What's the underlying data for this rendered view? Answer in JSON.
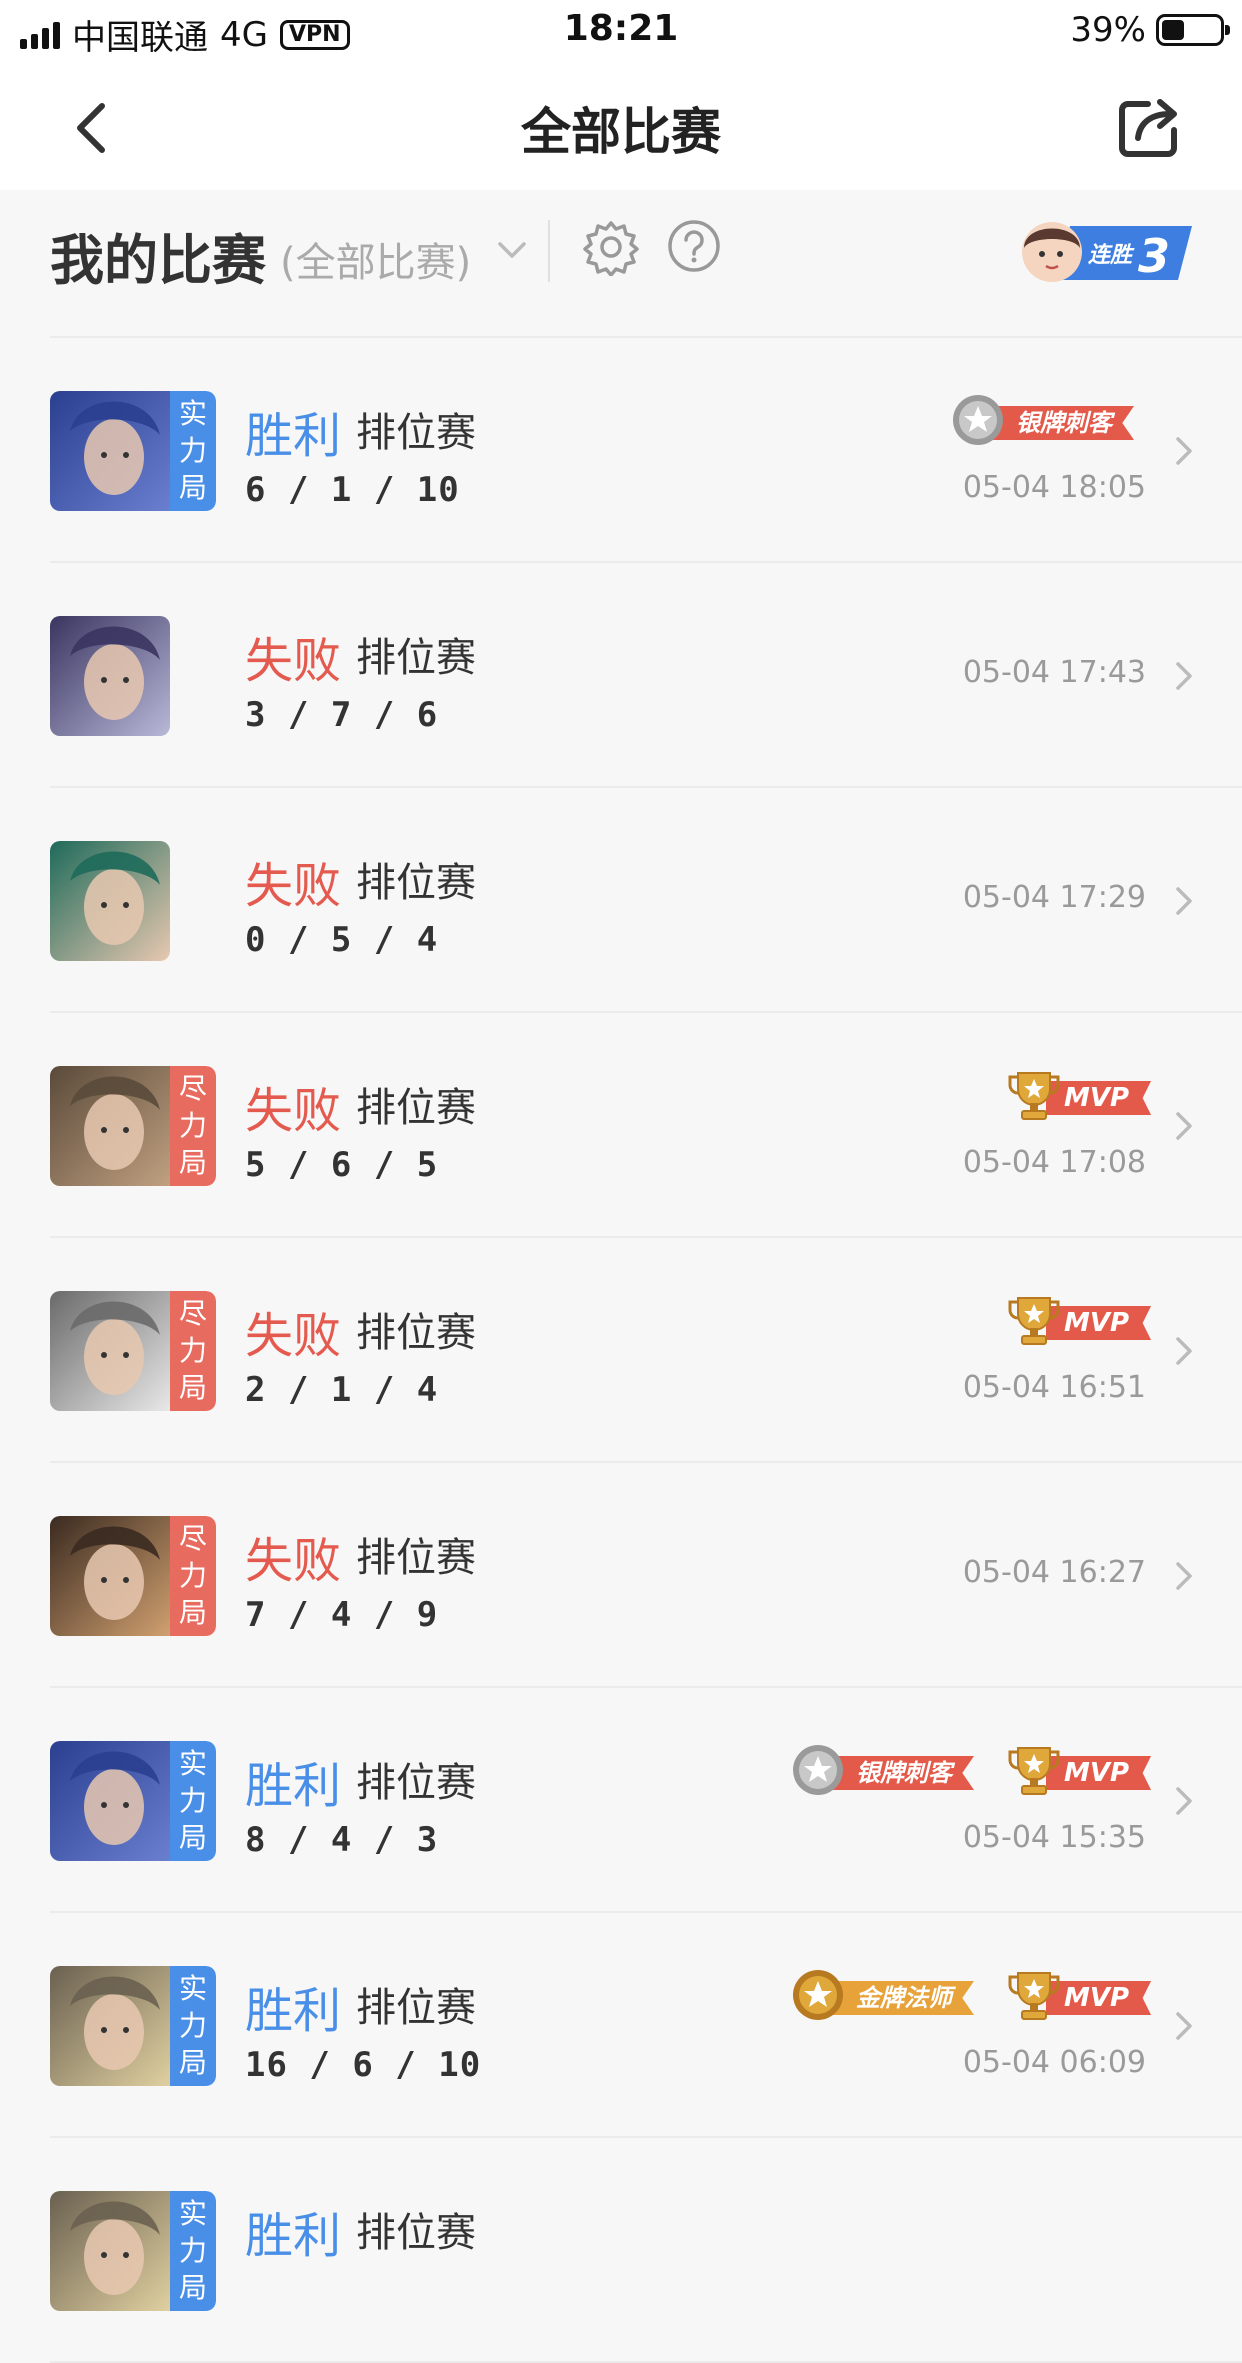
{
  "status_bar": {
    "carrier": "中国联通",
    "network": "4G",
    "vpn": "VPN",
    "time": "18:21",
    "battery": "39%",
    "battery_level": 0.39
  },
  "nav": {
    "title": "全部比赛"
  },
  "filter": {
    "title": "我的比赛",
    "subtitle": "(全部比赛)",
    "streak_label": "连胜",
    "streak_count": "3"
  },
  "matches": [
    {
      "result": "胜利",
      "mode": "排位赛",
      "kda": "6 / 1 / 10",
      "time": "05-04 18:05",
      "tier": [
        "实",
        "力",
        "局"
      ],
      "tier_color": "#4a8fe7",
      "badges": [
        {
          "type": "silver",
          "label": "银牌刺客"
        }
      ],
      "portrait_colors": [
        "#2a3f8f",
        "#6a7fd0"
      ]
    },
    {
      "result": "失败",
      "mode": "排位赛",
      "kda": "3 / 7 / 6",
      "time": "05-04 17:43",
      "tier": [],
      "badges": [],
      "portrait_colors": [
        "#3a3560",
        "#b8b8d8"
      ]
    },
    {
      "result": "失败",
      "mode": "排位赛",
      "kda": "0 / 5 / 4",
      "time": "05-04 17:29",
      "tier": [],
      "badges": [],
      "portrait_colors": [
        "#1e6a5a",
        "#e8c8b0"
      ]
    },
    {
      "result": "失败",
      "mode": "排位赛",
      "kda": "5 / 6 / 5",
      "time": "05-04 17:08",
      "tier": [
        "尽",
        "力",
        "局"
      ],
      "tier_color": "#e76b5e",
      "badges": [
        {
          "type": "mvp",
          "label": "MVP"
        }
      ],
      "portrait_colors": [
        "#5a4a3a",
        "#c0a080"
      ]
    },
    {
      "result": "失败",
      "mode": "排位赛",
      "kda": "2 / 1 / 4",
      "time": "05-04 16:51",
      "tier": [
        "尽",
        "力",
        "局"
      ],
      "tier_color": "#e76b5e",
      "badges": [
        {
          "type": "mvp",
          "label": "MVP"
        }
      ],
      "portrait_colors": [
        "#6a6a6a",
        "#e8e8e8"
      ]
    },
    {
      "result": "失败",
      "mode": "排位赛",
      "kda": "7 / 4 / 9",
      "time": "05-04 16:27",
      "tier": [
        "尽",
        "力",
        "局"
      ],
      "tier_color": "#e76b5e",
      "badges": [],
      "portrait_colors": [
        "#3a2a20",
        "#d0a070"
      ]
    },
    {
      "result": "胜利",
      "mode": "排位赛",
      "kda": "8 / 4 / 3",
      "time": "05-04 15:35",
      "tier": [
        "实",
        "力",
        "局"
      ],
      "tier_color": "#4a8fe7",
      "badges": [
        {
          "type": "silver",
          "label": "银牌刺客"
        },
        {
          "type": "mvp",
          "label": "MVP"
        }
      ],
      "portrait_colors": [
        "#2a3f8f",
        "#6a7fd0"
      ]
    },
    {
      "result": "胜利",
      "mode": "排位赛",
      "kda": "16 / 6 / 10",
      "time": "05-04 06:09",
      "tier": [
        "实",
        "力",
        "局"
      ],
      "tier_color": "#4a8fe7",
      "badges": [
        {
          "type": "gold",
          "label": "金牌法师"
        },
        {
          "type": "mvp",
          "label": "MVP"
        }
      ],
      "portrait_colors": [
        "#6a6050",
        "#e0d0a0"
      ]
    },
    {
      "result": "胜利",
      "mode": "排位赛",
      "kda": "",
      "time": "",
      "tier": [
        "实",
        "力",
        "局"
      ],
      "tier_color": "#4a8fe7",
      "badges": [],
      "portrait_colors": [
        "#6a6050",
        "#e0d0a0"
      ]
    }
  ],
  "colors": {
    "win": "#4a8fe7",
    "loss": "#e55a4e",
    "accent_red": "#e35a4a",
    "gold": "#e8a23a"
  }
}
